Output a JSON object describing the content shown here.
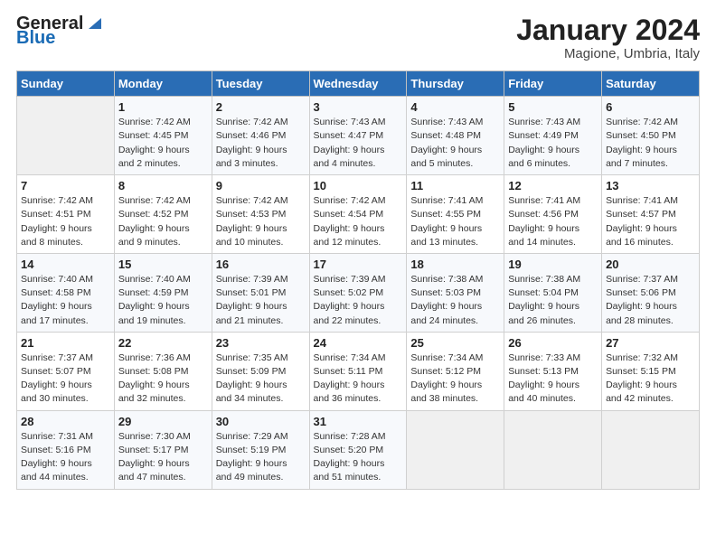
{
  "header": {
    "logo_general": "General",
    "logo_blue": "Blue",
    "main_title": "January 2024",
    "sub_title": "Magione, Umbria, Italy"
  },
  "columns": [
    "Sunday",
    "Monday",
    "Tuesday",
    "Wednesday",
    "Thursday",
    "Friday",
    "Saturday"
  ],
  "weeks": [
    [
      {
        "day": "",
        "info": ""
      },
      {
        "day": "1",
        "info": "Sunrise: 7:42 AM\nSunset: 4:45 PM\nDaylight: 9 hours\nand 2 minutes."
      },
      {
        "day": "2",
        "info": "Sunrise: 7:42 AM\nSunset: 4:46 PM\nDaylight: 9 hours\nand 3 minutes."
      },
      {
        "day": "3",
        "info": "Sunrise: 7:43 AM\nSunset: 4:47 PM\nDaylight: 9 hours\nand 4 minutes."
      },
      {
        "day": "4",
        "info": "Sunrise: 7:43 AM\nSunset: 4:48 PM\nDaylight: 9 hours\nand 5 minutes."
      },
      {
        "day": "5",
        "info": "Sunrise: 7:43 AM\nSunset: 4:49 PM\nDaylight: 9 hours\nand 6 minutes."
      },
      {
        "day": "6",
        "info": "Sunrise: 7:42 AM\nSunset: 4:50 PM\nDaylight: 9 hours\nand 7 minutes."
      }
    ],
    [
      {
        "day": "7",
        "info": "Sunrise: 7:42 AM\nSunset: 4:51 PM\nDaylight: 9 hours\nand 8 minutes."
      },
      {
        "day": "8",
        "info": "Sunrise: 7:42 AM\nSunset: 4:52 PM\nDaylight: 9 hours\nand 9 minutes."
      },
      {
        "day": "9",
        "info": "Sunrise: 7:42 AM\nSunset: 4:53 PM\nDaylight: 9 hours\nand 10 minutes."
      },
      {
        "day": "10",
        "info": "Sunrise: 7:42 AM\nSunset: 4:54 PM\nDaylight: 9 hours\nand 12 minutes."
      },
      {
        "day": "11",
        "info": "Sunrise: 7:41 AM\nSunset: 4:55 PM\nDaylight: 9 hours\nand 13 minutes."
      },
      {
        "day": "12",
        "info": "Sunrise: 7:41 AM\nSunset: 4:56 PM\nDaylight: 9 hours\nand 14 minutes."
      },
      {
        "day": "13",
        "info": "Sunrise: 7:41 AM\nSunset: 4:57 PM\nDaylight: 9 hours\nand 16 minutes."
      }
    ],
    [
      {
        "day": "14",
        "info": "Sunrise: 7:40 AM\nSunset: 4:58 PM\nDaylight: 9 hours\nand 17 minutes."
      },
      {
        "day": "15",
        "info": "Sunrise: 7:40 AM\nSunset: 4:59 PM\nDaylight: 9 hours\nand 19 minutes."
      },
      {
        "day": "16",
        "info": "Sunrise: 7:39 AM\nSunset: 5:01 PM\nDaylight: 9 hours\nand 21 minutes."
      },
      {
        "day": "17",
        "info": "Sunrise: 7:39 AM\nSunset: 5:02 PM\nDaylight: 9 hours\nand 22 minutes."
      },
      {
        "day": "18",
        "info": "Sunrise: 7:38 AM\nSunset: 5:03 PM\nDaylight: 9 hours\nand 24 minutes."
      },
      {
        "day": "19",
        "info": "Sunrise: 7:38 AM\nSunset: 5:04 PM\nDaylight: 9 hours\nand 26 minutes."
      },
      {
        "day": "20",
        "info": "Sunrise: 7:37 AM\nSunset: 5:06 PM\nDaylight: 9 hours\nand 28 minutes."
      }
    ],
    [
      {
        "day": "21",
        "info": "Sunrise: 7:37 AM\nSunset: 5:07 PM\nDaylight: 9 hours\nand 30 minutes."
      },
      {
        "day": "22",
        "info": "Sunrise: 7:36 AM\nSunset: 5:08 PM\nDaylight: 9 hours\nand 32 minutes."
      },
      {
        "day": "23",
        "info": "Sunrise: 7:35 AM\nSunset: 5:09 PM\nDaylight: 9 hours\nand 34 minutes."
      },
      {
        "day": "24",
        "info": "Sunrise: 7:34 AM\nSunset: 5:11 PM\nDaylight: 9 hours\nand 36 minutes."
      },
      {
        "day": "25",
        "info": "Sunrise: 7:34 AM\nSunset: 5:12 PM\nDaylight: 9 hours\nand 38 minutes."
      },
      {
        "day": "26",
        "info": "Sunrise: 7:33 AM\nSunset: 5:13 PM\nDaylight: 9 hours\nand 40 minutes."
      },
      {
        "day": "27",
        "info": "Sunrise: 7:32 AM\nSunset: 5:15 PM\nDaylight: 9 hours\nand 42 minutes."
      }
    ],
    [
      {
        "day": "28",
        "info": "Sunrise: 7:31 AM\nSunset: 5:16 PM\nDaylight: 9 hours\nand 44 minutes."
      },
      {
        "day": "29",
        "info": "Sunrise: 7:30 AM\nSunset: 5:17 PM\nDaylight: 9 hours\nand 47 minutes."
      },
      {
        "day": "30",
        "info": "Sunrise: 7:29 AM\nSunset: 5:19 PM\nDaylight: 9 hours\nand 49 minutes."
      },
      {
        "day": "31",
        "info": "Sunrise: 7:28 AM\nSunset: 5:20 PM\nDaylight: 9 hours\nand 51 minutes."
      },
      {
        "day": "",
        "info": ""
      },
      {
        "day": "",
        "info": ""
      },
      {
        "day": "",
        "info": ""
      }
    ]
  ]
}
